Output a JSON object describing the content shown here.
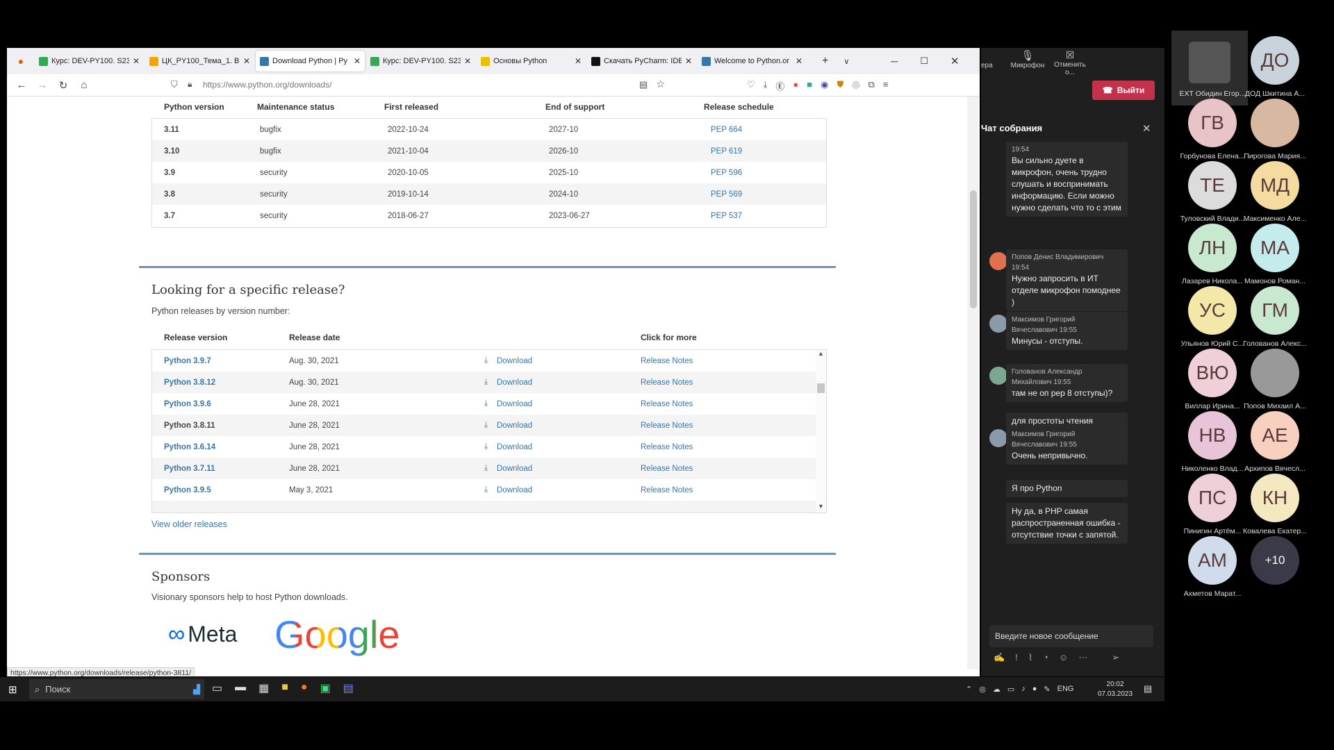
{
  "browser": {
    "tabs": [
      {
        "label": "Курс: DEV-PY100. S23.",
        "color": "#34a853",
        "active": false
      },
      {
        "label": "ЦК_PY100_Тема_1. Ве",
        "color": "#f4a300",
        "active": false
      },
      {
        "label": "Download Python | Py",
        "color": "#3776ab",
        "active": true
      },
      {
        "label": "Курс: DEV-PY100. S23.",
        "color": "#34a853",
        "active": false
      },
      {
        "label": "Основы Python",
        "color": "#e8c200",
        "active": false
      },
      {
        "label": "Скачать PyCharm: IDE",
        "color": "#111111",
        "active": false
      },
      {
        "label": "Welcome to Python.or",
        "color": "#3776ab",
        "active": false
      }
    ],
    "url": "https://www.python.org/downloads/",
    "status_url": "https://www.python.org/downloads/release/python-3811/"
  },
  "versions_table": {
    "headers": [
      "Python version",
      "Maintenance status",
      "First released",
      "End of support",
      "Release schedule"
    ],
    "rows": [
      [
        "3.11",
        "bugfix",
        "2022-10-24",
        "2027-10",
        "PEP 664"
      ],
      [
        "3.10",
        "bugfix",
        "2021-10-04",
        "2026-10",
        "PEP 619"
      ],
      [
        "3.9",
        "security",
        "2020-10-05",
        "2025-10",
        "PEP 596"
      ],
      [
        "3.8",
        "security",
        "2019-10-14",
        "2024-10",
        "PEP 569"
      ],
      [
        "3.7",
        "security",
        "2018-06-27",
        "2023-06-27",
        "PEP 537"
      ]
    ]
  },
  "specific": {
    "title": "Looking for a specific release?",
    "subtitle": "Python releases by version number:",
    "headers": [
      "Release version",
      "Release date",
      "",
      "Click for more"
    ],
    "download_label": "Download",
    "notes_label": "Release Notes",
    "rows": [
      [
        "Python 3.9.7",
        "Aug. 30, 2021"
      ],
      [
        "Python 3.8.12",
        "Aug. 30, 2021"
      ],
      [
        "Python 3.9.6",
        "June 28, 2021"
      ],
      [
        "Python 3.8.11",
        "June 28, 2021"
      ],
      [
        "Python 3.6.14",
        "June 28, 2021"
      ],
      [
        "Python 3.7.11",
        "June 28, 2021"
      ],
      [
        "Python 3.9.5",
        "May 3, 2021"
      ]
    ],
    "view_older": "View older releases"
  },
  "sponsors": {
    "title": "Sponsors",
    "subtitle": "Visionary sponsors help to host Python downloads.",
    "meta": "Meta",
    "google": "Google"
  },
  "taskbar": {
    "search": "Поиск",
    "lang": "ENG",
    "time": "20:02",
    "date": "07.03.2023"
  },
  "teams": {
    "top_buttons": {
      "camera": "ера",
      "mic": "Микрофон",
      "share": "Отменить о...",
      "leave": "Выйти"
    },
    "chat_title": "Чат собрания",
    "messages": [
      {
        "author": "",
        "time": "19:54",
        "text": "Вы сильно дуете в микрофон, очень трудно слушать и воспринимать информацию. Если можно нужно сделать что то с этим"
      },
      {
        "author": "Попов Денис Владимирович",
        "time": "19:54",
        "text": "Нужно запросить в ИТ отделе микрофон помоднее )"
      },
      {
        "author": "Максимов Григорий Вячеславович",
        "time": "19:55",
        "text": "Минусы - отступы."
      },
      {
        "author": "Голованов Александр Михайлович",
        "time": "19:55",
        "text": "там не оп pep 8 отступы)?"
      },
      {
        "author": "",
        "time": "",
        "text": "для простоты чтения"
      },
      {
        "author": "Максимов Григорий Вячеславович",
        "time": "19:55",
        "text": "Очень непривычно."
      },
      {
        "author": "",
        "time": "",
        "text": "Я про Python"
      },
      {
        "author": "",
        "time": "",
        "text": "Ну да, в PHP самая распространенная ошибка - отсутствие точки с запятой."
      }
    ],
    "input_placeholder": "Введите новое сообщение"
  },
  "participants": [
    {
      "initials": "",
      "name": "EXT Обидин Егор...",
      "color": "#555555"
    },
    {
      "initials": "ДО",
      "name": "ДОД Шкитина А...",
      "color": "#c9d3dc"
    },
    {
      "initials": "ГВ",
      "name": "Горбунова Елена...",
      "color": "#e8c4c8"
    },
    {
      "initials": "",
      "name": "Пирогова Мария...",
      "color": "#d8b8a0"
    },
    {
      "initials": "ТЕ",
      "name": "Туловский Влади...",
      "color": "#dcdcdc"
    },
    {
      "initials": "МД",
      "name": "Максименко Але...",
      "color": "#f4dca0"
    },
    {
      "initials": "ЛН",
      "name": "Лазарев Никола...",
      "color": "#c8e8d0"
    },
    {
      "initials": "МА",
      "name": "Мамонов Роман...",
      "color": "#c4ecec"
    },
    {
      "initials": "УС",
      "name": "Ульянов Юрий С...",
      "color": "#f4e8a8"
    },
    {
      "initials": "ГМ",
      "name": "Голованов Алекс...",
      "color": "#c8e8d0"
    },
    {
      "initials": "ВЮ",
      "name": "Виллар Ирина...",
      "color": "#f0d0d8"
    },
    {
      "initials": "",
      "name": "Попов Михаил А...",
      "color": "#999999"
    },
    {
      "initials": "НВ",
      "name": "Николенко Влад...",
      "color": "#e8c4d8"
    },
    {
      "initials": "АЕ",
      "name": "Архипов Вячесл...",
      "color": "#f8d0c0"
    },
    {
      "initials": "ПС",
      "name": "Пинигин Артём...",
      "color": "#f0d0d8"
    },
    {
      "initials": "КН",
      "name": "Ковалева Екатер...",
      "color": "#f4e8c0"
    },
    {
      "initials": "АМ",
      "name": "Ахметов Марат...",
      "color": "#d0dcec"
    },
    {
      "initials": "+10",
      "name": "",
      "color": "#3a3a48"
    }
  ]
}
